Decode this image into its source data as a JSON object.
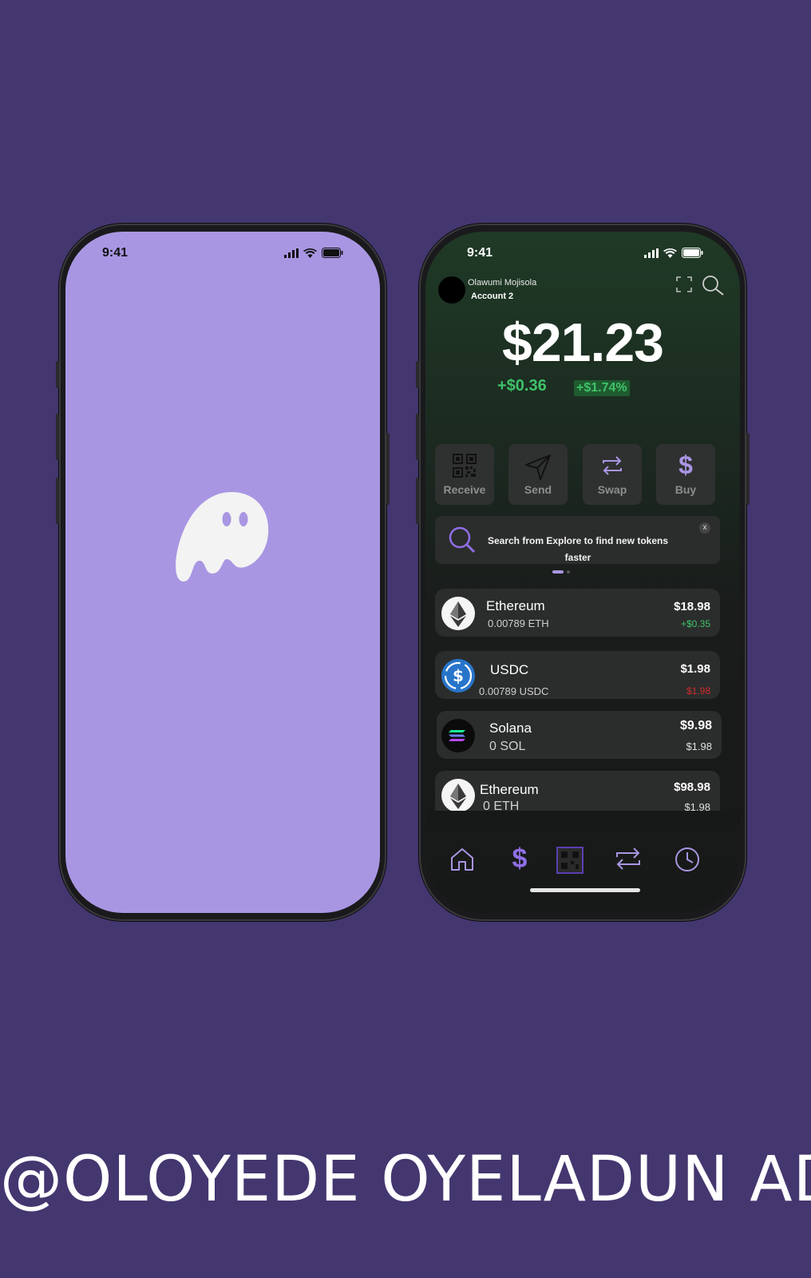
{
  "phone1": {
    "status_time": "9:41",
    "background_color": "#a996e3",
    "logo_icon": "ghost-icon"
  },
  "phone2": {
    "status_time": "9:41",
    "user": {
      "name": "Olawumi Mojisola",
      "account": "Account 2"
    },
    "balance": "$21.23",
    "change_amount": "+$0.36",
    "change_percent": "+$1.74%",
    "actions": [
      {
        "label": "Receive",
        "icon": "qr-code-icon"
      },
      {
        "label": "Send",
        "icon": "send-icon"
      },
      {
        "label": "Swap",
        "icon": "swap-icon"
      },
      {
        "label": "Buy",
        "icon": "dollar-icon"
      }
    ],
    "banner": {
      "text": "Search from Explore to find new tokens faster",
      "close": "x"
    },
    "tokens": [
      {
        "name": "Ethereum",
        "amount": "0.00789 ETH",
        "value": "$18.98",
        "change": "+$0.35",
        "change_color": "#3fc26a"
      },
      {
        "name": "USDC",
        "amount": "0.00789  USDC",
        "value": "$1.98",
        "change": "$1.98",
        "change_color": "#d12b2b"
      },
      {
        "name": "Solana",
        "amount": "0  SOL",
        "value": "$9.98",
        "change": "$1.98",
        "change_color": "#e0e0e0"
      },
      {
        "name": "Ethereum",
        "amount": "0  ETH",
        "value": "$98.98",
        "change": "$1.98",
        "change_color": "#e0e0e0"
      }
    ],
    "nav": [
      "home-icon",
      "dollar-icon",
      "qr-code-icon",
      "swap-icon",
      "clock-icon"
    ],
    "accent": "#a996e3"
  },
  "footer_text": "@OLOYEDE OYELADUN AD"
}
